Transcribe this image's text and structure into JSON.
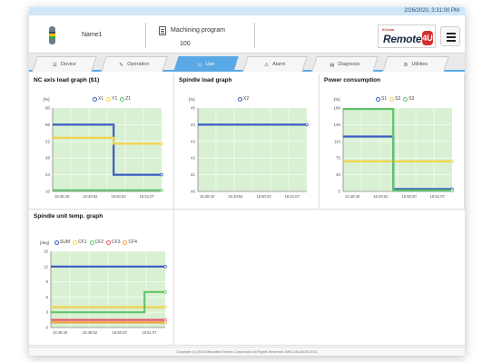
{
  "header": {
    "datetime": "2/26/2020, 3:31:00 PM",
    "machine_name": "Name1",
    "program_title": "Machining program",
    "program_number": "100",
    "logo_small": "KOram",
    "logo_text": "Remote",
    "logo_badge": "4U"
  },
  "tabs": [
    {
      "label": "Device",
      "icon": "list-icon",
      "active": false
    },
    {
      "label": "Operation",
      "icon": "pencil-icon",
      "active": false
    },
    {
      "label": "Use",
      "icon": "monitor-icon",
      "active": true
    },
    {
      "label": "Alarm",
      "icon": "warning-icon",
      "active": false
    },
    {
      "label": "Diagnosis",
      "icon": "document-icon",
      "active": false
    },
    {
      "label": "Utilities",
      "icon": "gear-icon",
      "active": false
    }
  ],
  "panels": {
    "nc_axis": {
      "title": "NC axis load graph ($1)",
      "unit": "[%]",
      "legend": [
        "X1",
        "Y1",
        "Z1"
      ],
      "yticks": [
        "80",
        "66",
        "52",
        "38",
        "24",
        "10"
      ],
      "xticks": [
        "15:48:40",
        "15:49:52",
        "15:50:20",
        "15:51:07"
      ]
    },
    "spindle_load": {
      "title": "Spindle load graph",
      "unit": "[%]",
      "legend": [
        "X2"
      ],
      "yticks": [
        "45",
        "44",
        "43",
        "42",
        "41",
        "40"
      ],
      "xticks": [
        "15:48:40",
        "15:49:52",
        "15:50:20",
        "15:51:07"
      ]
    },
    "power": {
      "title": "Power consumption",
      "unit": "[%]",
      "legend": [
        "S1",
        "S2",
        "S3"
      ],
      "yticks": [
        "180",
        "145",
        "110",
        "75",
        "40",
        "5"
      ],
      "xticks": [
        "15:48:40",
        "15:49:52",
        "15:50:20",
        "15:51:07"
      ]
    },
    "spindle_temp": {
      "title": "Spindle unit temp. graph",
      "unit": "[deg]",
      "legend": [
        "SUM",
        "CF1",
        "CF2",
        "CF3",
        "CF4"
      ],
      "yticks": [
        "15",
        "12",
        "9",
        "6",
        "3",
        "0"
      ],
      "xticks": [
        "15:48:40",
        "15:49:52",
        "15:50:20",
        "15:51:07"
      ]
    }
  },
  "colors": {
    "accent": "#5aa9e6",
    "plot_bg": "#d9f0d3",
    "series_blue": "#3b5bc4",
    "series_yellow": "#f2d34c",
    "series_green": "#62c46a",
    "series_red": "#e2586b",
    "series_orange": "#f0a040"
  },
  "chart_data": [
    {
      "type": "line",
      "title": "NC axis load graph ($1)",
      "ylabel": "[%]",
      "ylim": [
        10,
        80
      ],
      "x": [
        "15:48:40",
        "15:49:52",
        "15:50:20",
        "15:51:07"
      ],
      "series": [
        {
          "name": "X1",
          "color": "#3b5bc4",
          "points": [
            [
              0,
              66
            ],
            [
              0.56,
              66
            ],
            [
              0.56,
              24
            ],
            [
              1,
              24
            ]
          ]
        },
        {
          "name": "Y1",
          "color": "#f2d34c",
          "points": [
            [
              0,
              55
            ],
            [
              0.56,
              55
            ],
            [
              0.56,
              50
            ],
            [
              1,
              50
            ]
          ]
        },
        {
          "name": "Z1",
          "color": "#62c46a",
          "points": [
            [
              0,
              11
            ],
            [
              1,
              11
            ]
          ]
        }
      ]
    },
    {
      "type": "line",
      "title": "Spindle load graph",
      "ylabel": "[%]",
      "ylim": [
        40,
        45
      ],
      "x": [
        "15:48:40",
        "15:49:52",
        "15:50:20",
        "15:51:07"
      ],
      "series": [
        {
          "name": "X2",
          "color": "#3b5bc4",
          "points": [
            [
              0,
              44
            ],
            [
              1,
              44
            ]
          ]
        }
      ]
    },
    {
      "type": "line",
      "title": "Power consumption",
      "ylabel": "[%]",
      "ylim": [
        5,
        180
      ],
      "x": [
        "15:48:40",
        "15:49:52",
        "15:50:20",
        "15:51:07"
      ],
      "series": [
        {
          "name": "S1",
          "color": "#3b5bc4",
          "points": [
            [
              0,
              120
            ],
            [
              0.46,
              120
            ],
            [
              0.46,
              10
            ],
            [
              1,
              10
            ]
          ]
        },
        {
          "name": "S2",
          "color": "#f2d34c",
          "points": [
            [
              0,
              68
            ],
            [
              1,
              68
            ]
          ]
        },
        {
          "name": "S3",
          "color": "#62c46a",
          "points": [
            [
              0,
              178
            ],
            [
              0.46,
              178
            ],
            [
              0.46,
              7
            ],
            [
              1,
              7
            ]
          ]
        }
      ]
    },
    {
      "type": "line",
      "title": "Spindle unit temp. graph",
      "ylabel": "[deg]",
      "ylim": [
        0,
        15
      ],
      "x": [
        "15:48:40",
        "15:49:52",
        "15:50:20",
        "15:51:07"
      ],
      "series": [
        {
          "name": "SUM",
          "color": "#3b5bc4",
          "points": [
            [
              0,
              12
            ],
            [
              1,
              12
            ]
          ]
        },
        {
          "name": "CF1",
          "color": "#f2d34c",
          "points": [
            [
              0,
              4
            ],
            [
              1,
              4
            ]
          ]
        },
        {
          "name": "CF2",
          "color": "#62c46a",
          "points": [
            [
              0,
              3
            ],
            [
              0.82,
              3
            ],
            [
              0.82,
              7
            ],
            [
              1,
              7
            ]
          ]
        },
        {
          "name": "CF3",
          "color": "#e2586b",
          "points": [
            [
              0,
              1.5
            ],
            [
              1,
              1.5
            ]
          ]
        },
        {
          "name": "CF4",
          "color": "#f0a040",
          "points": [
            [
              0,
              1
            ],
            [
              1,
              1
            ]
          ]
        }
      ]
    }
  ],
  "footer": "Copyright (c) 2018 Mitsubishi Electric Corporation All Rights Reserved. BHD-1814A000-XXC"
}
